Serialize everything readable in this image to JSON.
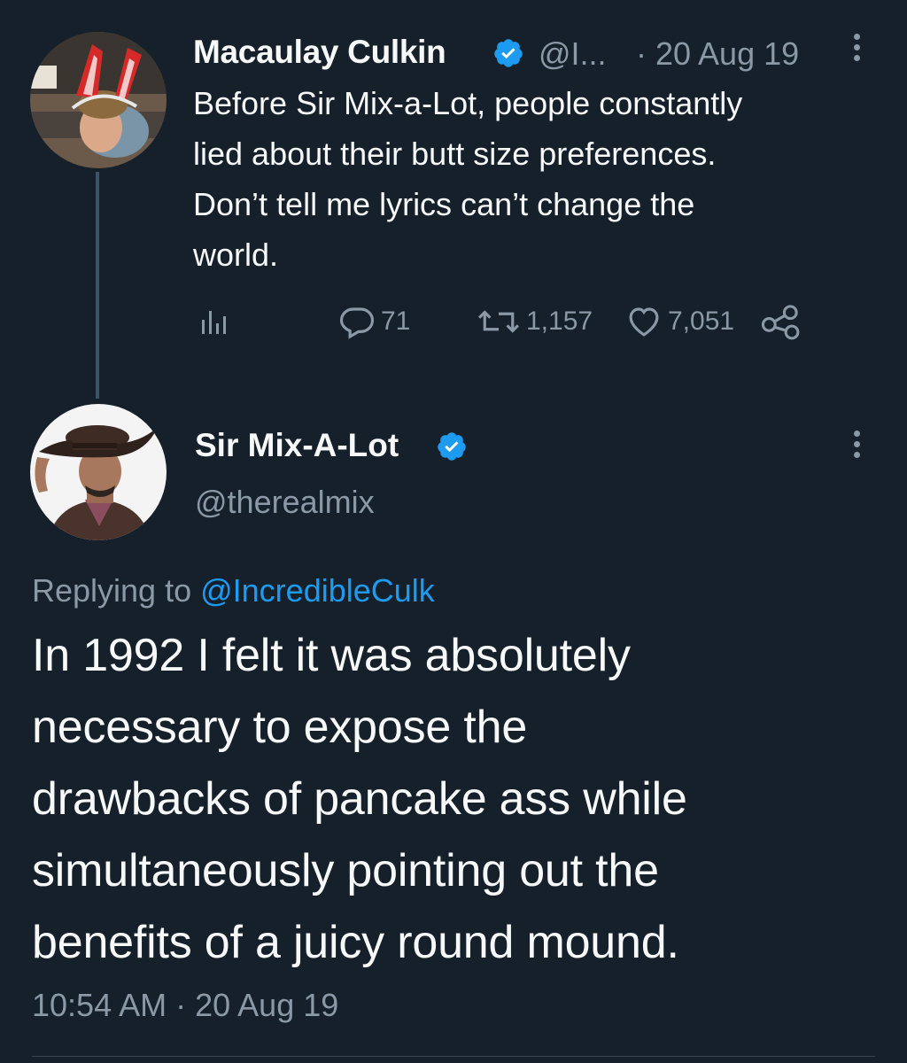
{
  "colors": {
    "background": "#15202b",
    "primary_text": "#f7f9f9",
    "secondary_text": "#8b98a5",
    "accent": "#1d9bf0",
    "thread_line": "#3d5466"
  },
  "parent_tweet": {
    "author_name": "Macaulay Culkin",
    "handle": "@I...",
    "date": "· 20 Aug 19",
    "verified_icon": "verified-badge-icon",
    "text_lines": [
      "Before Sir Mix-a-Lot, people constantly",
      "lied about their butt size preferences.",
      "Don’t tell me lyrics can’t change the",
      "world."
    ],
    "actions": {
      "analytics_icon": "analytics-icon",
      "reply_icon": "reply-icon",
      "reply_count": "71",
      "retweet_icon": "retweet-icon",
      "retweet_count": "1,157",
      "like_icon": "heart-icon",
      "like_count": "7,051",
      "share_icon": "share-icon"
    }
  },
  "reply_tweet": {
    "author_name": "Sir Mix-A-Lot",
    "handle": "@therealmix",
    "verified_icon": "verified-badge-icon",
    "replying_prefix": "Replying to ",
    "replying_mention": "@IncredibleCulk",
    "text_lines": [
      "In 1992 I felt it was absolutely",
      "necessary to expose the",
      "drawbacks of pancake ass while",
      "simultaneously pointing out the",
      "benefits of a juicy round mound."
    ],
    "timestamp": "10:54 AM · 20 Aug 19"
  }
}
